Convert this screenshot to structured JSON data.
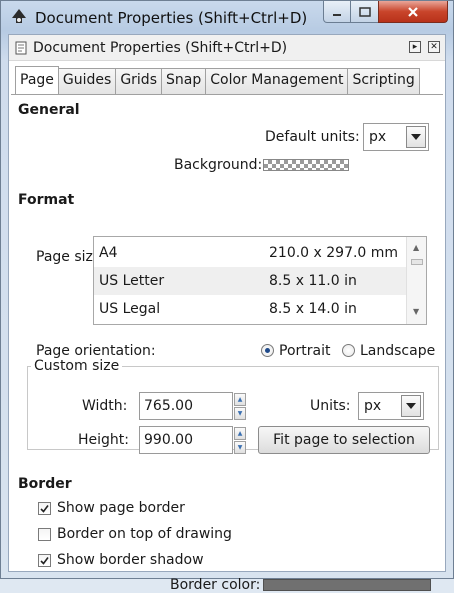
{
  "window": {
    "title": "Document Properties (Shift+Ctrl+D)",
    "controls": {
      "minimize": "—",
      "maximize": "□",
      "close": "✕"
    }
  },
  "dock": {
    "title": "Document Properties (Shift+Ctrl+D)",
    "buttons": [
      "▸",
      "✕"
    ]
  },
  "tabs": [
    "Page",
    "Guides",
    "Grids",
    "Snap",
    "Color Management",
    "Scripting"
  ],
  "general": {
    "heading": "General",
    "default_units_label": "Default units:",
    "default_units_value": "px",
    "background_label": "Background:"
  },
  "format": {
    "heading": "Format",
    "page_size_label": "Page size:",
    "page_sizes": [
      {
        "name": "A4",
        "size": "210.0 x 297.0 mm"
      },
      {
        "name": "US Letter",
        "size": "8.5 x 11.0 in"
      },
      {
        "name": "US Legal",
        "size": "8.5 x 14.0 in"
      }
    ],
    "selected_page_size": "US Letter",
    "orientation_label": "Page orientation:",
    "orientation_options": [
      "Portrait",
      "Landscape"
    ],
    "orientation_selected": "Portrait"
  },
  "custom_size": {
    "title": "Custom size",
    "width_label": "Width:",
    "width_value": "765.00",
    "height_label": "Height:",
    "height_value": "990.00",
    "units_label": "Units:",
    "units_value": "px",
    "fit_button": "Fit page to selection"
  },
  "border": {
    "heading": "Border",
    "options": [
      {
        "label": "Show page border",
        "checked": true
      },
      {
        "label": "Border on top of drawing",
        "checked": false
      },
      {
        "label": "Show border shadow",
        "checked": true
      }
    ],
    "border_color_label": "Border color:",
    "border_color": "#707070"
  },
  "colors": {
    "close_button": "#c9452b",
    "title_bar": "#b7cbe3"
  },
  "icons": [
    "inkscape-app-icon",
    "dock-document-icon",
    "dropdown-arrow-icon",
    "spin-up-icon",
    "spin-down-icon",
    "checkmark-icon"
  ]
}
